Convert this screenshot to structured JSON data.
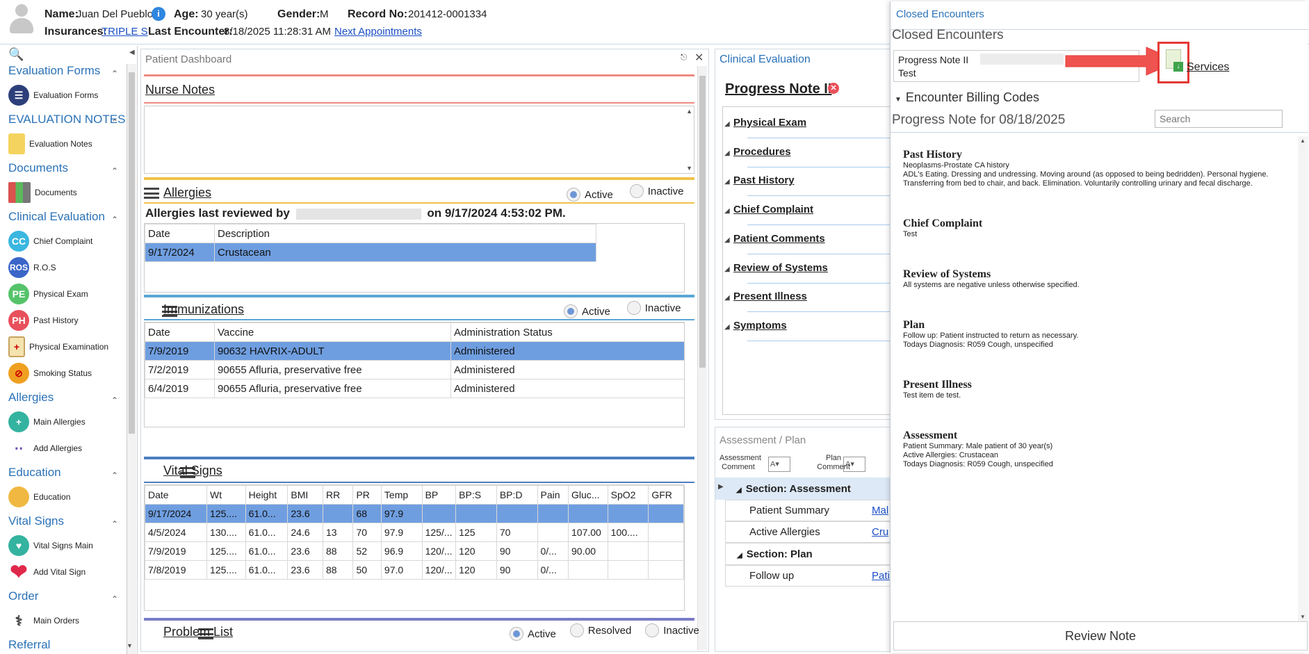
{
  "header": {
    "name_label": "Name:",
    "name": "Juan Del Pueblo",
    "age_label": "Age:",
    "age": "30 year(s)",
    "gender_label": "Gender:",
    "gender": "M",
    "record_label": "Record No:",
    "record": "201412-0001334",
    "ins_label": "Insurances:",
    "insurance": "TRIPLE S",
    "last_enc_label": "Last Encounter:",
    "last_enc": "8/18/2025 11:28:31 AM",
    "next_appt": "Next Appointments"
  },
  "sidebar": {
    "sections": [
      {
        "title": "Evaluation Forms",
        "items": [
          {
            "label": "Evaluation Forms"
          }
        ]
      },
      {
        "title": "EVALUATION NOTES",
        "items": [
          {
            "label": "Evaluation Notes"
          }
        ]
      },
      {
        "title": "Documents",
        "items": [
          {
            "label": "Documents"
          }
        ]
      },
      {
        "title": "Clinical Evaluation",
        "items": [
          {
            "label": "Chief Complaint",
            "abbr": "CC"
          },
          {
            "label": "R.O.S",
            "abbr": "ROS"
          },
          {
            "label": "Physical Exam",
            "abbr": "PE"
          },
          {
            "label": "Past History",
            "abbr": "PH"
          },
          {
            "label": "Physical Examination"
          },
          {
            "label": "Smoking Status"
          }
        ]
      },
      {
        "title": "Allergies",
        "items": [
          {
            "label": "Main Allergies"
          },
          {
            "label": "Add Allergies"
          }
        ]
      },
      {
        "title": "Education",
        "items": [
          {
            "label": "Education"
          }
        ]
      },
      {
        "title": "Vital Signs",
        "items": [
          {
            "label": "Vital Signs Main"
          },
          {
            "label": "Add Vital Sign"
          }
        ]
      },
      {
        "title": "Order",
        "items": [
          {
            "label": "Main Orders"
          }
        ]
      },
      {
        "title": "Referral",
        "items": []
      }
    ]
  },
  "dashboard": {
    "title": "Patient Dashboard",
    "nurse_notes": "Nurse Notes",
    "allergies": {
      "title": "Allergies",
      "active": "Active",
      "inactive": "Inactive",
      "reviewed_prefix": "Allergies last reviewed by",
      "reviewed_suffix": "on 9/17/2024 4:53:02 PM.",
      "cols": [
        "Date",
        "Description"
      ],
      "rows": [
        [
          "9/17/2024",
          "Crustacean"
        ]
      ]
    },
    "immunizations": {
      "title": "Immunizations",
      "active": "Active",
      "inactive": "Inactive",
      "cols": [
        "Date",
        "Vaccine",
        "Administration Status"
      ],
      "rows": [
        [
          "7/9/2019",
          "90632 HAVRIX-ADULT",
          "Administered"
        ],
        [
          "7/2/2019",
          "90655 Afluria, preservative free",
          "Administered"
        ],
        [
          "6/4/2019",
          "90655 Afluria, preservative free",
          "Administered"
        ]
      ]
    },
    "vitals": {
      "title": "Vital Signs",
      "cols": [
        "Date",
        "Wt",
        "Height",
        "BMI",
        "RR",
        "PR",
        "Temp",
        "BP",
        "BP:S",
        "BP:D",
        "Pain",
        "Gluc...",
        "SpO2",
        "GFR"
      ],
      "rows": [
        [
          "9/17/2024",
          "125....",
          "61.0...",
          "23.6",
          "",
          "68",
          "97.9",
          "",
          "",
          "",
          "",
          "",
          "",
          ""
        ],
        [
          "4/5/2024",
          "130....",
          "61.0...",
          "24.6",
          "13",
          "70",
          "97.9",
          "125/...",
          "125",
          "70",
          "",
          "107.00",
          "100....",
          ""
        ],
        [
          "7/9/2019",
          "125....",
          "61.0...",
          "23.6",
          "88",
          "52",
          "96.9",
          "120/...",
          "120",
          "90",
          "0/...",
          "90.00",
          "",
          ""
        ],
        [
          "7/8/2019",
          "125....",
          "61.0...",
          "23.6",
          "88",
          "50",
          "97.0",
          "120/...",
          "120",
          "90",
          "0/...",
          "",
          "",
          ""
        ]
      ]
    },
    "problem_list": {
      "title": "Problem List",
      "active": "Active",
      "resolved": "Resolved",
      "inactive": "Inactive"
    }
  },
  "clinical": {
    "title": "Clinical Evaluation",
    "note": "Progress Note II",
    "items": [
      "Physical Exam",
      "Procedures",
      "Past History",
      "Chief Complaint",
      "Patient Comments",
      "Review of Systems",
      "Present Illness",
      "Symptoms"
    ]
  },
  "assessment": {
    "title": "Assessment / Plan",
    "assess_comment": "Assessment Comment",
    "plan_comment": "Plan Comment",
    "sec_assessment": "Section: Assessment",
    "patient_summary": "Patient Summary",
    "patient_summary_val": "Mal",
    "active_allergies": "Active Allergies",
    "active_allergies_val": "Cru",
    "sec_plan": "Section: Plan",
    "follow_up": "Follow up",
    "follow_up_val": "Pati"
  },
  "closed": {
    "link_title": "Closed Encounters",
    "title": "Closed Encounters",
    "enc_line1": "Progress Note II",
    "enc_line2": "Test",
    "services": "Services",
    "billing": "Encounter Billing Codes",
    "note_for": "Progress Note for 08/18/2025",
    "search_placeholder": "Search",
    "review_btn": "Review Note",
    "note": [
      {
        "h": "Past History",
        "t": [
          "Neoplasms-Prostate CA history",
          "ADL's Eating. Dressing and undressing. Moving around (as opposed to being bedridden). Personal hygiene. Transferring from bed to chair, and back. Elimination. Voluntarily controlling urinary and fecal discharge."
        ]
      },
      {
        "h": "Chief Complaint",
        "t": [
          "Test"
        ]
      },
      {
        "h": "Review of Systems",
        "t": [
          "All systems are negative unless otherwise specified."
        ]
      },
      {
        "h": "Plan",
        "t": [
          "Follow up: Patient instructed to return as necessary.",
          "Todays Diagnosis: R059 Cough, unspecified"
        ]
      },
      {
        "h": "Present Illness",
        "t": [
          "Test item de test."
        ]
      },
      {
        "h": "Assessment",
        "t": [
          "Patient Summary: Male patient of 30 year(s)",
          "Active Allergies: Crustacean",
          "Todays Diagnosis: R059 Cough, unspecified"
        ]
      }
    ]
  },
  "colors": {
    "accent": "#2a72b8",
    "selected_row": "#6f9ee0",
    "highlight_red": "#e53935",
    "nurse_bar": "#f08a80",
    "allergy_bar": "#f0c24a",
    "immun_bar": "#5aa6d6",
    "vital_bar": "#4a7fc1",
    "problem_bar": "#7b7bc9"
  }
}
